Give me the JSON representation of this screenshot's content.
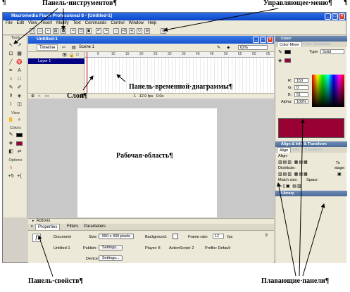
{
  "annotations": {
    "tools_panel": "Панель·инструментов¶",
    "main_menu": "Управляющее·меню¶",
    "layers": "Слои¶",
    "timeline_panel": "Панель·временной·диаграммы¶",
    "work_area": "Рабочая·область¶",
    "properties_panel": "Панель·свойств¶",
    "floating_panels": "Плавающие·панели¶",
    "pilcrow": "¶"
  },
  "window": {
    "title": "Macromedia Flash Professional 8 - [Untitled-1]",
    "minimize": "_",
    "maximize": "□",
    "close": "×"
  },
  "menu": [
    "File",
    "Edit",
    "View",
    "Insert",
    "Modify",
    "Text",
    "Commands",
    "Control",
    "Window",
    "Help"
  ],
  "tools": {
    "tools_label": "Tools",
    "view_label": "View",
    "colors_label": "Colors",
    "options_label": "Options"
  },
  "document": {
    "title": "Untitled-1",
    "timeline_tab": "Timeline",
    "scene": "Scene 1",
    "zoom": "62%",
    "layer_name": "Layer 1",
    "ruler_marks": [
      "5",
      "10",
      "15",
      "20",
      "25",
      "30",
      "35",
      "40",
      "45",
      "50",
      "55",
      "60",
      "65"
    ],
    "footer_frame": "1",
    "footer_fps": "12.0 fps",
    "footer_time": "0.0s"
  },
  "color_panel": {
    "header": "Color",
    "tab_mixer": "Color Mixer",
    "tab_swatches": "Color Swatches",
    "type_label": "Type:",
    "type_value": "Solid",
    "r_label": "R:",
    "r_value": "153",
    "g_label": "G:",
    "g_value": "0",
    "b_label": "B:",
    "b_value": "51",
    "alpha_label": "Alpha:",
    "alpha_value": "100%",
    "hex_value": "#990033",
    "swatch_color": "#990033"
  },
  "align_panel": {
    "header": "Align & Info & Transform",
    "tab_align": "Align",
    "tab_info": "Info",
    "tab_transform": "Transform",
    "align_label": "Align:",
    "distribute_label": "Distribute:",
    "match_label": "Match size:",
    "space_label": "Space:",
    "to_label": "To",
    "stage_label": "stage:"
  },
  "library_panel": {
    "header": "Library"
  },
  "properties": {
    "actions_label": "Actions",
    "tab_properties": "Properties",
    "tab_filters": "Filters",
    "tab_parameters": "Parameters",
    "doc_type": "Document",
    "doc_name": "Untitled-1",
    "size_label": "Size:",
    "size_value": "550 x 400 pixels",
    "background_label": "Background:",
    "framerate_label": "Frame rate:",
    "framerate_value": "12",
    "fps": "fps",
    "publish_label": "Publish:",
    "settings_button": "Settings...",
    "player_text": "Player: 8",
    "actionscript_text": "ActionScript: 2",
    "profile_text": "Profile: Default",
    "device_label": "Device:",
    "device_button": "Settings..."
  }
}
